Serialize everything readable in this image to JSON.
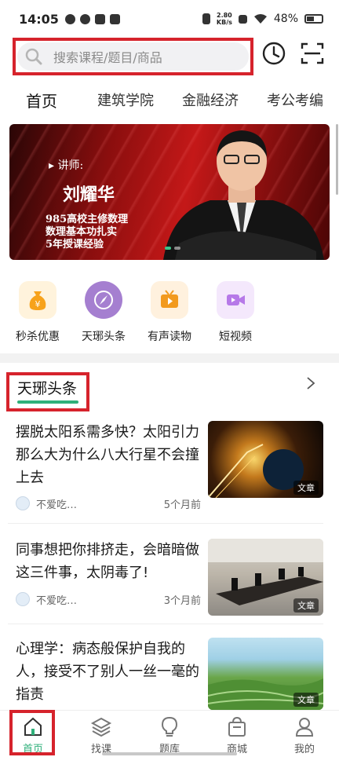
{
  "status_bar": {
    "time": "14:05",
    "net_speed_value": "2.80",
    "net_speed_unit": "KB/s",
    "battery": "48%"
  },
  "search": {
    "placeholder": "搜索课程/题目/商品"
  },
  "tabs": [
    "首页",
    "建筑学院",
    "金融经济",
    "考公考编"
  ],
  "banner": {
    "tag": "讲师:",
    "name": "刘耀华",
    "lines": [
      "985高校主修数理",
      "数理基本功扎实",
      "5年授课经验"
    ]
  },
  "quick_links": [
    {
      "label": "秒杀优惠",
      "icon": "money-bag-icon",
      "color": "#f7a21b"
    },
    {
      "label": "天琊头条",
      "icon": "compass-icon",
      "color": "#a57fd0"
    },
    {
      "label": "有声读物",
      "icon": "tv-play-icon",
      "color": "#f29a1e"
    },
    {
      "label": "短视频",
      "icon": "video-camera-icon",
      "color": "#b679e8"
    }
  ],
  "news": {
    "title": "天琊头条",
    "articles": [
      {
        "title": "摆脱太阳系需多快？太阳引力那么大为什么八大行星不会撞上去",
        "author": "不爱吃…",
        "time": "5个月前",
        "badge": "文章"
      },
      {
        "title": "同事想把你排挤走，会暗暗做这三件事，太阴毒了!",
        "author": "不爱吃…",
        "time": "3个月前",
        "badge": "文章"
      },
      {
        "title": "心理学：病态般保护自我的人，接受不了别人一丝一毫的指责",
        "author": "",
        "time": "",
        "badge": "文章"
      }
    ]
  },
  "bottom_nav": [
    "首页",
    "找课",
    "题库",
    "商城",
    "我的"
  ],
  "colors": {
    "accent": "#2fb07a",
    "highlight": "#d6232c"
  }
}
